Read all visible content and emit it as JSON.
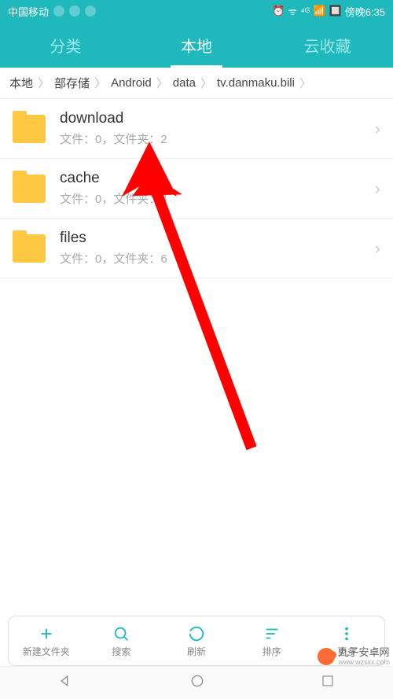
{
  "status": {
    "carrier": "中国移动",
    "time": "傍晚6:35"
  },
  "tabs": [
    {
      "label": "分类"
    },
    {
      "label": "本地"
    },
    {
      "label": "云收藏"
    }
  ],
  "breadcrumb": [
    "本地",
    "部存储",
    "Android",
    "data",
    "tv.danmaku.bili"
  ],
  "files": [
    {
      "name": "download",
      "meta": "文件：0，文件夹：2"
    },
    {
      "name": "cache",
      "meta": "文件：0，文件夹：4"
    },
    {
      "name": "files",
      "meta": "文件：0，文件夹：6"
    }
  ],
  "bottomBar": [
    {
      "label": "新建文件夹"
    },
    {
      "label": "搜索"
    },
    {
      "label": "刷新"
    },
    {
      "label": "排序"
    },
    {
      "label": "更多"
    }
  ],
  "watermark": {
    "title": "丸子安卓网",
    "sub": "www.wzsxx.com"
  }
}
